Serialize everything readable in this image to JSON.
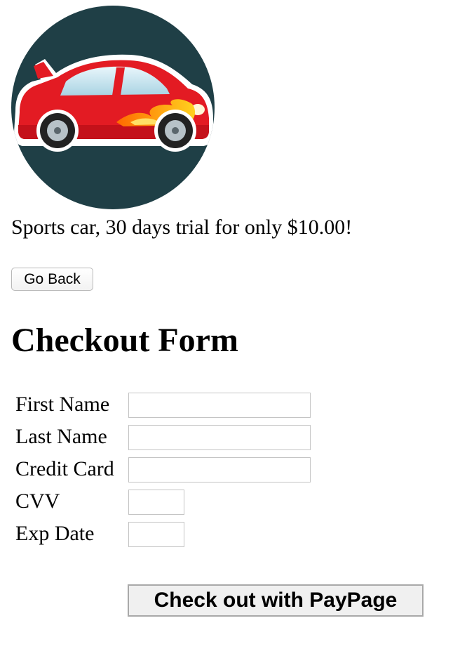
{
  "product": {
    "image_name": "sports-car-icon",
    "description": "Sports car, 30 days trial for only $10.00!"
  },
  "nav": {
    "back_label": "Go Back"
  },
  "form": {
    "title": "Checkout Form",
    "fields": {
      "first_name": {
        "label": "First Name",
        "value": ""
      },
      "last_name": {
        "label": "Last Name",
        "value": ""
      },
      "credit_card": {
        "label": "Credit Card",
        "value": ""
      },
      "cvv": {
        "label": "CVV",
        "value": ""
      },
      "exp_date": {
        "label": "Exp Date",
        "value": ""
      }
    },
    "submit_label": "Check out with PayPage"
  },
  "colors": {
    "icon_background": "#1f3f46",
    "car_body": "#e31b23",
    "flame": "#ffc61a"
  }
}
